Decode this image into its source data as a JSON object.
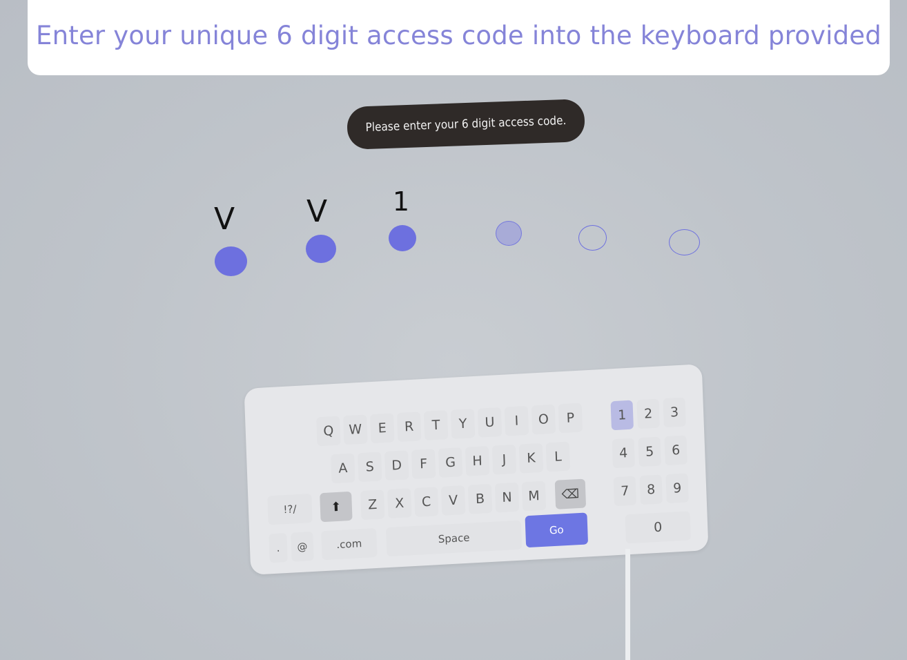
{
  "banner": {
    "text": "Enter your unique 6 digit access code into the keyboard provided"
  },
  "tooltip": {
    "text": "Please enter your 6 digit access code."
  },
  "code": {
    "entered": [
      "V",
      "V",
      "1"
    ],
    "total_digits": 6,
    "states": [
      "filled",
      "filled",
      "filled",
      "active",
      "empty",
      "empty"
    ]
  },
  "keyboard": {
    "row1": [
      "Q",
      "W",
      "E",
      "R",
      "T",
      "Y",
      "U",
      "I",
      "O",
      "P"
    ],
    "row2": [
      "A",
      "S",
      "D",
      "F",
      "G",
      "H",
      "J",
      "K",
      "L"
    ],
    "row3": [
      "Z",
      "X",
      "C",
      "V",
      "B",
      "N",
      "M"
    ],
    "symbols_label": "!?/",
    "period_label": ".",
    "at_label": "@",
    "dotcom_label": ".com",
    "space_label": "Space",
    "go_label": "Go",
    "numpad": [
      "1",
      "2",
      "3",
      "4",
      "5",
      "6",
      "7",
      "8",
      "9",
      "0"
    ],
    "colors": {
      "accent": "#6d76e3",
      "banner_text": "#8584d8",
      "dot": "#6d70df"
    }
  }
}
